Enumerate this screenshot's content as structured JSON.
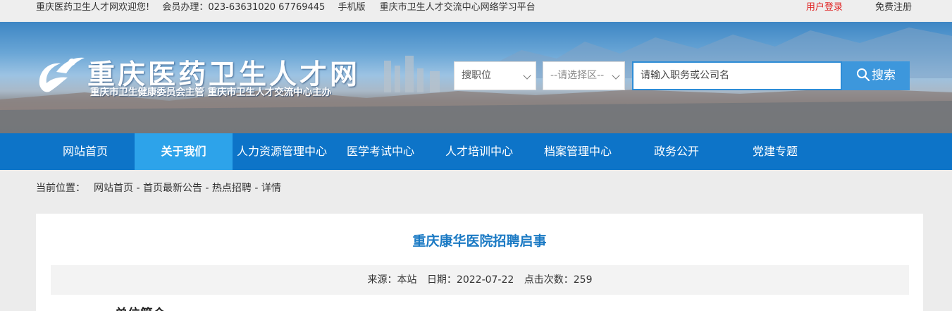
{
  "topbar": {
    "welcome": "重庆医药卫生人才网欢迎您!",
    "member": "会员办理：023-63631020 67769445",
    "mobile": "手机版",
    "platform": "重庆市卫生人才交流中心网络学习平台",
    "login": "用户登录",
    "register": "免费注册"
  },
  "header": {
    "site_title": "重庆医药卫生人才网",
    "subtitle": "重庆市卫生健康委员会主管  重庆市卫生人才交流中心主办",
    "select_job": "搜职位",
    "select_area": "--请选择区--",
    "search_placeholder": "请输入职务或公司名",
    "search_button": "搜索"
  },
  "nav": {
    "items": [
      "网站首页",
      "关于我们",
      "人力资源管理中心",
      "医学考试中心",
      "人才培训中心",
      "档案管理中心",
      "政务公开",
      "党建专题"
    ],
    "active_index": 1
  },
  "breadcrumb": {
    "label": "当前位置：",
    "path": [
      "网站首页",
      "首页最新公告",
      "热点招聘",
      "详情"
    ],
    "separator": " - "
  },
  "article": {
    "title": "重庆康华医院招聘启事",
    "source": "来源：本站",
    "date": "日期：2022-07-22",
    "clicks": "点击次数：259",
    "section_heading": "单位简介"
  },
  "colors": {
    "nav": "#0d74c8",
    "nav_active": "#2da3ea",
    "title": "#1b7ac4",
    "login": "#e02020"
  }
}
